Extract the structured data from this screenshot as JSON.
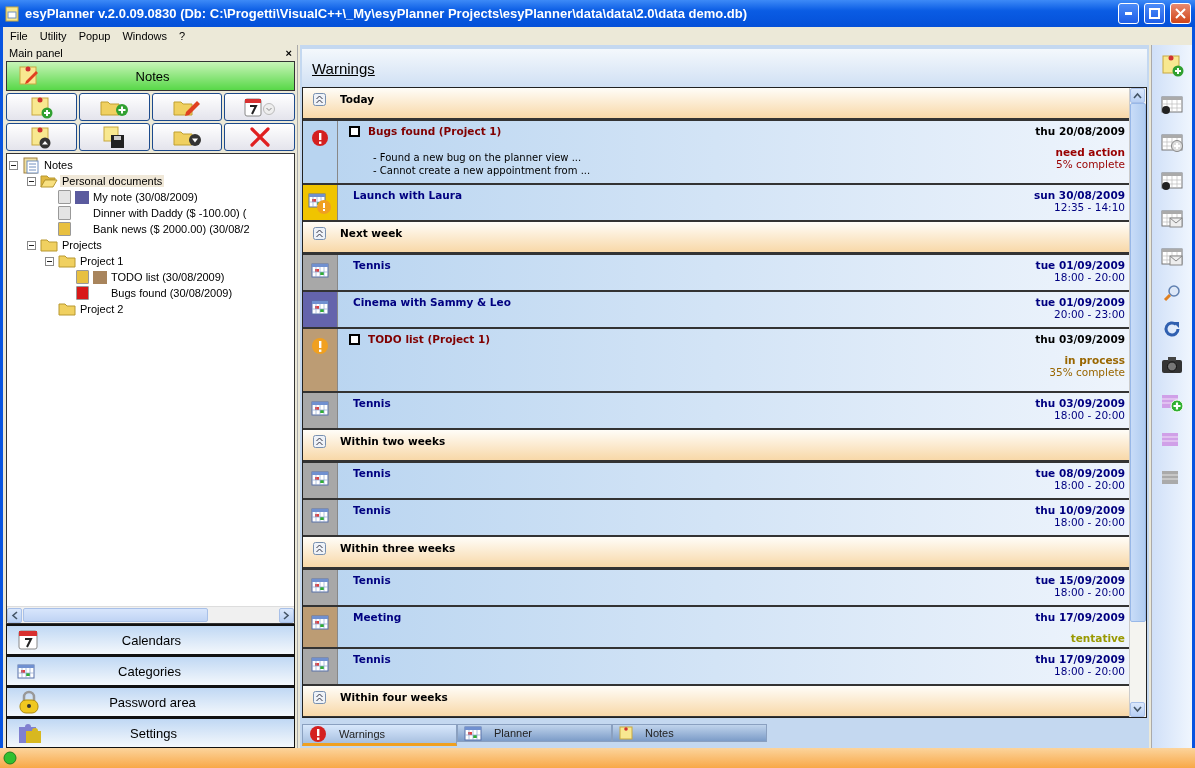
{
  "window": {
    "title": "esyPlanner v.2.0.09.0830 (Db: C:\\Progetti\\VisualC++\\_My\\esyPlanner Projects\\esyPlanner\\data\\data\\2.0\\data demo.db)"
  },
  "menu": [
    "File",
    "Utility",
    "Popup",
    "Windows",
    "?"
  ],
  "main_panel": {
    "title": "Main panel",
    "close": "×",
    "active_section": {
      "label": "Notes",
      "kind": "notes",
      "selected": true
    },
    "toolbar": [
      {
        "kind": "new-note"
      },
      {
        "kind": "new-folder"
      },
      {
        "kind": "edit"
      },
      {
        "kind": "calendar-menu"
      },
      {
        "kind": "note-up"
      },
      {
        "kind": "save"
      },
      {
        "kind": "folder-down"
      },
      {
        "kind": "delete"
      }
    ],
    "tree": [
      {
        "label": "Notes",
        "kind": "root",
        "expanded": true,
        "selected": false,
        "children": [
          {
            "label": "Personal documents",
            "kind": "folder-open",
            "expanded": true,
            "selected": true,
            "children": [
              {
                "label": "My note (30/08/2009)",
                "kind": "note",
                "color": "#5a5a9e",
                "selected": false
              },
              {
                "label": "Dinner with Daddy ($ -100.00) (",
                "kind": "note",
                "selected": false
              },
              {
                "label": "Bank news ($ 2000.00) (30/08/2",
                "kind": "memo",
                "selected": false
              }
            ]
          },
          {
            "label": "Projects",
            "kind": "folder",
            "expanded": true,
            "selected": false,
            "children": [
              {
                "label": "Project 1",
                "kind": "folder",
                "expanded": true,
                "selected": false,
                "children": [
                  {
                    "label": "TODO list (30/08/2009)",
                    "kind": "memo",
                    "color": "#a8845c",
                    "selected": false
                  },
                  {
                    "label": "Bugs found (30/08/2009)",
                    "kind": "bug",
                    "selected": false
                  }
                ]
              },
              {
                "label": "Project 2",
                "kind": "folder",
                "selected": false
              }
            ]
          }
        ]
      }
    ],
    "sections": [
      {
        "label": "Calendars",
        "kind": "calendar",
        "selected": false
      },
      {
        "label": "Categories",
        "kind": "categories",
        "selected": false
      },
      {
        "label": "Password area",
        "kind": "lock",
        "selected": false
      },
      {
        "label": "Settings",
        "kind": "puzzle",
        "selected": false
      }
    ]
  },
  "warnings": {
    "title": "Warnings",
    "items": [
      {
        "kind": "group",
        "label": "Today"
      },
      {
        "kind": "urgent",
        "color": "#b8d4f0",
        "checked": false,
        "title": "Bugs found (Project 1)",
        "date": "thu 20/08/2009",
        "lines": [
          "- Found a new bug on the planner view ...",
          "- Cannot create a new appointment from ..."
        ],
        "status": "need action",
        "progress": "5% complete"
      },
      {
        "kind": "reminder",
        "color": "#f0c400",
        "title": "Launch with Laura",
        "date": "sun 30/08/2009",
        "time": "12:35 - 14:10"
      },
      {
        "kind": "group",
        "label": "Next week"
      },
      {
        "kind": "event",
        "color": "#a8a8a8",
        "title": "Tennis",
        "date": "tue 01/09/2009",
        "time": "18:00 - 20:00"
      },
      {
        "kind": "event",
        "color": "#6464ac",
        "title": "Cinema with Sammy & Leo",
        "date": "tue 01/09/2009",
        "time": "20:00 - 23:00"
      },
      {
        "kind": "task",
        "color": "#bc9c74",
        "checked": false,
        "title": "TODO list (Project 1)",
        "date": "thu 03/09/2009",
        "status": "in process",
        "progress": "35% complete"
      },
      {
        "kind": "event",
        "color": "#a8a8a8",
        "title": "Tennis",
        "date": "thu 03/09/2009",
        "time": "18:00 - 20:00"
      },
      {
        "kind": "group",
        "label": "Within two weeks"
      },
      {
        "kind": "event",
        "color": "#a8a8a8",
        "title": "Tennis",
        "date": "tue 08/09/2009",
        "time": "18:00 - 20:00"
      },
      {
        "kind": "event",
        "color": "#a8a8a8",
        "title": "Tennis",
        "date": "thu 10/09/2009",
        "time": "18:00 - 20:00"
      },
      {
        "kind": "group",
        "label": "Within three weeks"
      },
      {
        "kind": "event",
        "color": "#a8a8a8",
        "title": "Tennis",
        "date": "tue 15/09/2009",
        "time": "18:00 - 20:00"
      },
      {
        "kind": "event",
        "color": "#bc9c74",
        "title": "Meeting",
        "date": "thu 17/09/2009",
        "status": "tentative"
      },
      {
        "kind": "event",
        "color": "#a8a8a8",
        "title": "Tennis",
        "date": "thu 17/09/2009",
        "time": "18:00 - 20:00"
      },
      {
        "kind": "group",
        "label": "Within four weeks"
      }
    ]
  },
  "bottom_tabs": [
    {
      "label": "Warnings",
      "kind": "alert",
      "selected": true
    },
    {
      "label": "Planner",
      "kind": "calendar",
      "selected": false
    },
    {
      "label": "Notes",
      "kind": "note",
      "selected": false
    }
  ],
  "side_tools": [
    {
      "kind": "note-add"
    },
    {
      "kind": "calendar-cam"
    },
    {
      "kind": "calendar-add"
    },
    {
      "kind": "calendar-cam"
    },
    {
      "kind": "calendar-mail"
    },
    {
      "kind": "calendar-mail"
    },
    {
      "kind": "magnifier"
    },
    {
      "kind": "refresh"
    },
    {
      "kind": "camera"
    },
    {
      "kind": "category-add"
    },
    {
      "kind": "category"
    },
    {
      "kind": "category-grey"
    }
  ]
}
